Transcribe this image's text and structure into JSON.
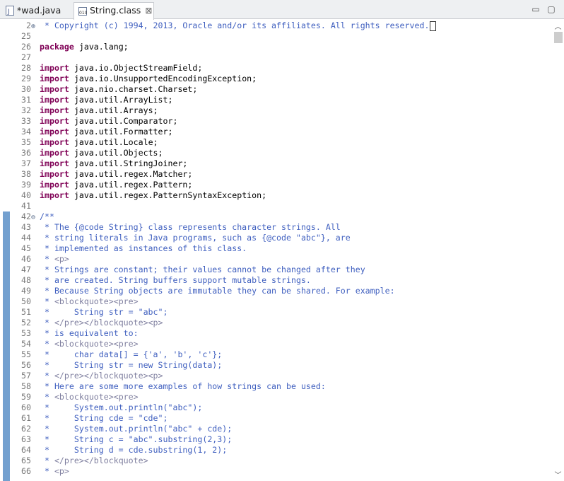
{
  "tabs": [
    {
      "label": "*wad.java"
    },
    {
      "label": "String.class"
    }
  ],
  "lines": [
    {
      "n": "2",
      "fold": "⊕",
      "text": " * Copyright (c) 1994, 2013, Oracle and/or its affiliates. All rights reserved.",
      "type": "cm",
      "box": true
    },
    {
      "n": "25",
      "text": ""
    },
    {
      "n": "26",
      "kw": "package",
      "text": " java.lang;"
    },
    {
      "n": "27",
      "text": ""
    },
    {
      "n": "28",
      "kw": "import",
      "text": " java.io.ObjectStreamField;"
    },
    {
      "n": "29",
      "kw": "import",
      "text": " java.io.UnsupportedEncodingException;"
    },
    {
      "n": "30",
      "kw": "import",
      "text": " java.nio.charset.Charset;"
    },
    {
      "n": "31",
      "kw": "import",
      "text": " java.util.ArrayList;"
    },
    {
      "n": "32",
      "kw": "import",
      "text": " java.util.Arrays;"
    },
    {
      "n": "33",
      "kw": "import",
      "text": " java.util.Comparator;"
    },
    {
      "n": "34",
      "kw": "import",
      "text": " java.util.Formatter;"
    },
    {
      "n": "35",
      "kw": "import",
      "text": " java.util.Locale;"
    },
    {
      "n": "36",
      "kw": "import",
      "text": " java.util.Objects;"
    },
    {
      "n": "37",
      "kw": "import",
      "text": " java.util.StringJoiner;"
    },
    {
      "n": "38",
      "kw": "import",
      "text": " java.util.regex.Matcher;"
    },
    {
      "n": "39",
      "kw": "import",
      "text": " java.util.regex.Pattern;"
    },
    {
      "n": "40",
      "kw": "import",
      "text": " java.util.regex.PatternSyntaxException;"
    },
    {
      "n": "41",
      "text": ""
    },
    {
      "n": "42",
      "fold": "⊖",
      "text": "/**",
      "type": "cm"
    },
    {
      "n": "43",
      "text": " * The {@code String} class represents character strings. All",
      "type": "cm"
    },
    {
      "n": "44",
      "text": " * string literals in Java programs, such as {@code \"abc\"}, are",
      "type": "cm"
    },
    {
      "n": "45",
      "text": " * implemented as instances of this class.",
      "type": "cm"
    },
    {
      "n": "46",
      "text": " * <p>",
      "type": "cmtag"
    },
    {
      "n": "47",
      "text": " * Strings are constant; their values cannot be changed after they",
      "type": "cm"
    },
    {
      "n": "48",
      "text": " * are created. String buffers support mutable strings.",
      "type": "cm"
    },
    {
      "n": "49",
      "text": " * Because String objects are immutable they can be shared. For example:",
      "type": "cm"
    },
    {
      "n": "50",
      "text": " * <blockquote><pre>",
      "type": "cmtag"
    },
    {
      "n": "51",
      "text": " *     String str = \"abc\";",
      "type": "cm"
    },
    {
      "n": "52",
      "text": " * </pre></blockquote><p>",
      "type": "cmtag"
    },
    {
      "n": "53",
      "text": " * is equivalent to:",
      "type": "cm"
    },
    {
      "n": "54",
      "text": " * <blockquote><pre>",
      "type": "cmtag"
    },
    {
      "n": "55",
      "text": " *     char data[] = {'a', 'b', 'c'};",
      "type": "cm"
    },
    {
      "n": "56",
      "text": " *     String str = new String(data);",
      "type": "cm"
    },
    {
      "n": "57",
      "text": " * </pre></blockquote><p>",
      "type": "cmtag"
    },
    {
      "n": "58",
      "text": " * Here are some more examples of how strings can be used:",
      "type": "cm"
    },
    {
      "n": "59",
      "text": " * <blockquote><pre>",
      "type": "cmtag"
    },
    {
      "n": "60",
      "text": " *     System.out.println(\"abc\");",
      "type": "cm"
    },
    {
      "n": "61",
      "text": " *     String cde = \"cde\";",
      "type": "cm"
    },
    {
      "n": "62",
      "text": " *     System.out.println(\"abc\" + cde);",
      "type": "cm"
    },
    {
      "n": "63",
      "text": " *     String c = \"abc\".substring(2,3);",
      "type": "cm"
    },
    {
      "n": "64",
      "text": " *     String d = cde.substring(1, 2);",
      "type": "cm"
    },
    {
      "n": "65",
      "text": " * </pre></blockquote>",
      "type": "cmtag"
    },
    {
      "n": "66",
      "text": " * <p>",
      "type": "cmtag"
    }
  ]
}
